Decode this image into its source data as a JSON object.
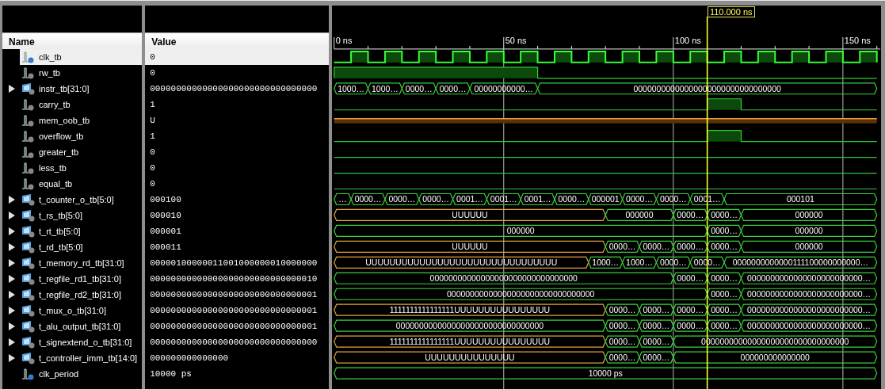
{
  "cursor": {
    "label": "110.000 ns"
  },
  "ruler": {
    "labels": [
      "0 ns",
      "50 ns",
      "100 ns",
      "150 ns"
    ]
  },
  "columns": {
    "name": "Name",
    "value": "Value"
  },
  "signals": [
    {
      "name": "clk_tb",
      "value": "0",
      "kind": "clock",
      "undefined": false,
      "selected": true
    },
    {
      "name": "rw_tb",
      "value": "0",
      "kind": "bit",
      "undefined": false,
      "selected": false
    },
    {
      "name": "instr_tb[31:0]",
      "value": "00000000000000000000000000000000",
      "kind": "bus",
      "expanded": false,
      "selected": false,
      "segments": [
        {
          "text": "1000…",
          "undefined": false
        },
        {
          "text": "1000…",
          "undefined": false
        },
        {
          "text": "0000…",
          "undefined": false
        },
        {
          "text": "0000…",
          "undefined": false
        },
        {
          "text": "00000000000…",
          "undefined": false
        },
        {
          "text": "00000000000000000000000000000000",
          "undefined": false
        }
      ]
    },
    {
      "name": "carry_tb",
      "value": "1",
      "kind": "bit",
      "undefined": false,
      "selected": false
    },
    {
      "name": "mem_oob_tb",
      "value": "U",
      "kind": "bit",
      "undefined": true,
      "selected": false
    },
    {
      "name": "overflow_tb",
      "value": "1",
      "kind": "bit",
      "undefined": false,
      "selected": false
    },
    {
      "name": "greater_tb",
      "value": "0",
      "kind": "bit",
      "undefined": false,
      "selected": false
    },
    {
      "name": "less_tb",
      "value": "0",
      "kind": "bit",
      "undefined": false,
      "selected": false
    },
    {
      "name": "equal_tb",
      "value": "0",
      "kind": "bit",
      "undefined": false,
      "selected": false
    },
    {
      "name": "t_counter_o_tb[5:0]",
      "value": "000100",
      "kind": "bus",
      "expanded": false,
      "selected": false,
      "segments": [
        {
          "text": "…",
          "undefined": false
        },
        {
          "text": "0000…",
          "undefined": false
        },
        {
          "text": "0000…",
          "undefined": false
        },
        {
          "text": "0000…",
          "undefined": false
        },
        {
          "text": "0001…",
          "undefined": false
        },
        {
          "text": "0001…",
          "undefined": false
        },
        {
          "text": "0001…",
          "undefined": false
        },
        {
          "text": "0000…",
          "undefined": false
        },
        {
          "text": "000001",
          "undefined": false
        },
        {
          "text": "0000…",
          "undefined": false
        },
        {
          "text": "0000…",
          "undefined": false
        },
        {
          "text": "0001…",
          "undefined": false
        },
        {
          "text": "000101",
          "undefined": false
        }
      ]
    },
    {
      "name": "t_rs_tb[5:0]",
      "value": "000010",
      "kind": "bus",
      "expanded": false,
      "selected": false,
      "segments": [
        {
          "text": "UUUUUU",
          "undefined": true
        },
        {
          "text": "000000",
          "undefined": false
        },
        {
          "text": "0000…",
          "undefined": false
        },
        {
          "text": "0000…",
          "undefined": false
        },
        {
          "text": "000000",
          "undefined": false
        }
      ]
    },
    {
      "name": "t_rt_tb[5:0]",
      "value": "000001",
      "kind": "bus",
      "expanded": false,
      "selected": false,
      "segments": [
        {
          "text": "000000",
          "undefined": false
        },
        {
          "text": "0000…",
          "undefined": false
        },
        {
          "text": "000000",
          "undefined": false
        }
      ]
    },
    {
      "name": "t_rd_tb[5:0]",
      "value": "000011",
      "kind": "bus",
      "expanded": false,
      "selected": false,
      "segments": [
        {
          "text": "UUUUUU",
          "undefined": true
        },
        {
          "text": "0000…",
          "undefined": false
        },
        {
          "text": "0000…",
          "undefined": false
        },
        {
          "text": "0000…",
          "undefined": false
        },
        {
          "text": "0000…",
          "undefined": false
        },
        {
          "text": "000000",
          "undefined": false
        }
      ]
    },
    {
      "name": "t_memory_rd_tb[31:0]",
      "value": "00000100000011001000000010000000",
      "kind": "bus",
      "expanded": false,
      "selected": false,
      "segments": [
        {
          "text": "UUUUUUUUUUUUUUUUUUUUUUUUUUUUUUUU",
          "undefined": true
        },
        {
          "text": "1000…",
          "undefined": false
        },
        {
          "text": "1000…",
          "undefined": false
        },
        {
          "text": "0000…",
          "undefined": false
        },
        {
          "text": "0000…",
          "undefined": false
        },
        {
          "text": "0000000000000111100000000000…",
          "undefined": false
        }
      ]
    },
    {
      "name": "t_regfile_rd1_tb[31:0]",
      "value": "00000000000000000000000000000010",
      "kind": "bus",
      "expanded": false,
      "selected": false,
      "segments": [
        {
          "text": "00000000000000000000000000000000",
          "undefined": false
        },
        {
          "text": "0000…",
          "undefined": false
        },
        {
          "text": "0000…",
          "undefined": false
        },
        {
          "text": "0000000000000000000000000…",
          "undefined": false
        }
      ]
    },
    {
      "name": "t_regfile_rd2_tb[31:0]",
      "value": "00000000000000000000000000000001",
      "kind": "bus",
      "expanded": false,
      "selected": false,
      "segments": [
        {
          "text": "00000000000000000000000000000000",
          "undefined": false
        },
        {
          "text": "0000…",
          "undefined": false
        },
        {
          "text": "0000000000000000000000000…",
          "undefined": false
        }
      ]
    },
    {
      "name": "t_mux_o_tb[31:0]",
      "value": "00000000000000000000000000000001",
      "kind": "bus",
      "expanded": false,
      "selected": false,
      "segments": [
        {
          "text": "1111111111111111UUUUUUUUUUUUUUUU",
          "undefined": true
        },
        {
          "text": "0000…",
          "undefined": false
        },
        {
          "text": "0000…",
          "undefined": false
        },
        {
          "text": "0000…",
          "undefined": false
        },
        {
          "text": "0000…",
          "undefined": false
        },
        {
          "text": "0000000000000000000000000…",
          "undefined": false
        }
      ]
    },
    {
      "name": "t_alu_output_tb[31:0]",
      "value": "00000000000000000000000000000001",
      "kind": "bus",
      "expanded": false,
      "selected": false,
      "segments": [
        {
          "text": "00000000000000000000000000000000",
          "undefined": false
        },
        {
          "text": "0000…",
          "undefined": false
        },
        {
          "text": "0000…",
          "undefined": false
        },
        {
          "text": "0000…",
          "undefined": false
        },
        {
          "text": "0000…",
          "undefined": false
        },
        {
          "text": "0000000000000000000000000…",
          "undefined": false
        }
      ]
    },
    {
      "name": "t_signextend_o_tb[31:0]",
      "value": "00000000000000000000000000000000",
      "kind": "bus",
      "expanded": false,
      "selected": false,
      "segments": [
        {
          "text": "1111111111111111UUUUUUUUUUUUUUUU",
          "undefined": true
        },
        {
          "text": "0000…",
          "undefined": false
        },
        {
          "text": "0000…",
          "undefined": false
        },
        {
          "text": "00000000000000000000000000000000",
          "undefined": false
        }
      ]
    },
    {
      "name": "t_controller_imm_tb[14:0]",
      "value": "000000000000000",
      "kind": "bus",
      "expanded": false,
      "selected": false,
      "segments": [
        {
          "text": "UUUUUUUUUUUUUUU",
          "undefined": true
        },
        {
          "text": "0000…",
          "undefined": false
        },
        {
          "text": "0000…",
          "undefined": false
        },
        {
          "text": "000000000000000",
          "undefined": false
        }
      ]
    },
    {
      "name": "clk_period",
      "value": "10000 ps",
      "kind": "const",
      "selected": false,
      "segments": [
        {
          "text": "10000 ps",
          "undefined": false
        }
      ]
    }
  ]
}
